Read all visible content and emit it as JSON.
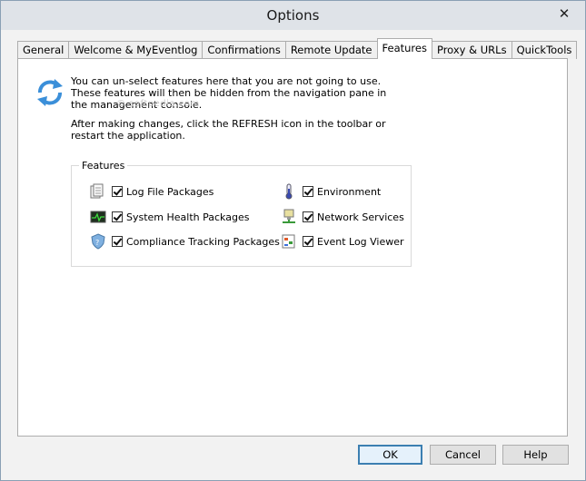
{
  "window": {
    "title": "Options",
    "close_glyph": "✕"
  },
  "tabs": [
    {
      "label": "General",
      "active": false
    },
    {
      "label": "Welcome & MyEventlog",
      "active": false
    },
    {
      "label": "Confirmations",
      "active": false
    },
    {
      "label": "Remote Update",
      "active": false
    },
    {
      "label": "Features",
      "active": true
    },
    {
      "label": "Proxy & URLs",
      "active": false
    },
    {
      "label": "QuickTools",
      "active": false
    }
  ],
  "content": {
    "description": "You can un-select features here that you are not going to use. These features will then be hidden from the navigation pane in the management console.",
    "refresh_note": "After making changes, click the REFRESH icon in the toolbar or restart the application.",
    "watermark": "© softpedia.com"
  },
  "features": {
    "legend": "Features",
    "items": [
      {
        "label": "Log File Packages",
        "checked": true,
        "icon": "log-file-icon"
      },
      {
        "label": "System Health Packages",
        "checked": true,
        "icon": "system-health-icon"
      },
      {
        "label": "Compliance Tracking Packages",
        "checked": true,
        "icon": "compliance-shield-icon"
      },
      {
        "label": "Environment",
        "checked": true,
        "icon": "thermometer-icon"
      },
      {
        "label": "Network Services",
        "checked": true,
        "icon": "network-computer-icon"
      },
      {
        "label": "Event Log Viewer",
        "checked": true,
        "icon": "event-log-icon"
      }
    ]
  },
  "buttons": {
    "ok": "OK",
    "cancel": "Cancel",
    "help": "Help"
  },
  "colors": {
    "default_button_border": "#3c7fb1",
    "refresh_icon": "#3b8fd9"
  }
}
